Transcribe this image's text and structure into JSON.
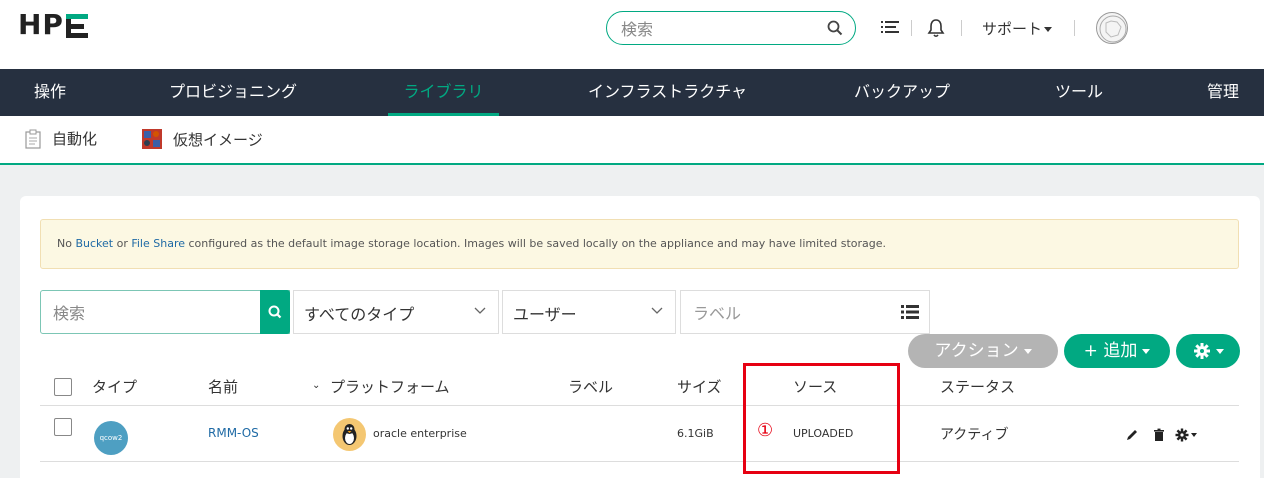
{
  "header": {
    "logo": "HPE",
    "search_placeholder": "検索",
    "support_label": "サポート"
  },
  "mainnav": [
    {
      "label": "操作"
    },
    {
      "label": "プロビジョニング"
    },
    {
      "label": "ライブラリ",
      "active": true
    },
    {
      "label": "インフラストラクチャ"
    },
    {
      "label": "バックアップ"
    },
    {
      "label": "ツール"
    },
    {
      "label": "管理"
    }
  ],
  "subnav": [
    {
      "label": "自動化",
      "icon": "clipboard-icon"
    },
    {
      "label": "仮想イメージ",
      "icon": "virtual-image-icon"
    }
  ],
  "alert": {
    "prefix": "No ",
    "bucket_link": "Bucket",
    "middle": " or ",
    "fileshare_link": "File Share",
    "suffix": " configured as the default image storage location. Images will be saved locally on the appliance and may have limited storage."
  },
  "filters": {
    "search_placeholder": "検索",
    "type_selected": "すべてのタイプ",
    "user_selected": "ユーザー",
    "label_placeholder": "ラベル"
  },
  "buttons": {
    "actions": "アクション",
    "add": "+ 追加"
  },
  "table": {
    "headers": {
      "type": "タイプ",
      "name": "名前",
      "platform": "プラットフォーム",
      "labels": "ラベル",
      "size": "サイズ",
      "source": "ソース",
      "status": "ステータス"
    },
    "rows": [
      {
        "type_badge": "qcow2",
        "name": "RMM-OS",
        "platform": "oracle enterprise",
        "size": "6.1GiB",
        "source": "UPLOADED",
        "status": "アクティブ"
      }
    ]
  },
  "annotation": {
    "marker": "①",
    "color": "#e60012"
  },
  "colors": {
    "accent": "#01a982",
    "nav_bg": "#263040",
    "actions_button": "#b4b4b4"
  }
}
